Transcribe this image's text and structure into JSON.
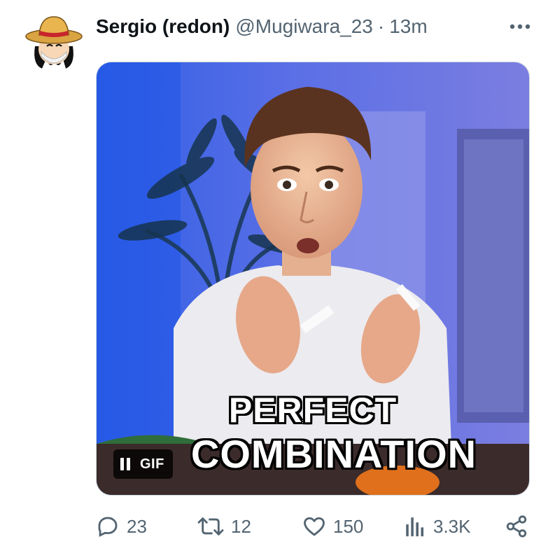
{
  "tweet": {
    "author": {
      "display_name": "Sergio (redon)",
      "handle": "@Mugiwara_23",
      "separator": "·",
      "time": "13m",
      "avatar_icon": "straw-hat-avatar"
    },
    "more_icon": "more-icon",
    "media": {
      "caption_line1": "PERFECT",
      "caption_line2": "COMBINATION",
      "gif_badge": "GIF",
      "pause_icon": "pause-icon"
    },
    "actions": {
      "replies": "23",
      "retweets": "12",
      "likes": "150",
      "views": "3.3K",
      "icons": [
        "reply-icon",
        "retweet-icon",
        "like-icon",
        "views-icon",
        "share-icon"
      ]
    },
    "colors": {
      "text_primary": "#0f1419",
      "text_secondary": "#536471",
      "border": "#cfd9de"
    }
  }
}
